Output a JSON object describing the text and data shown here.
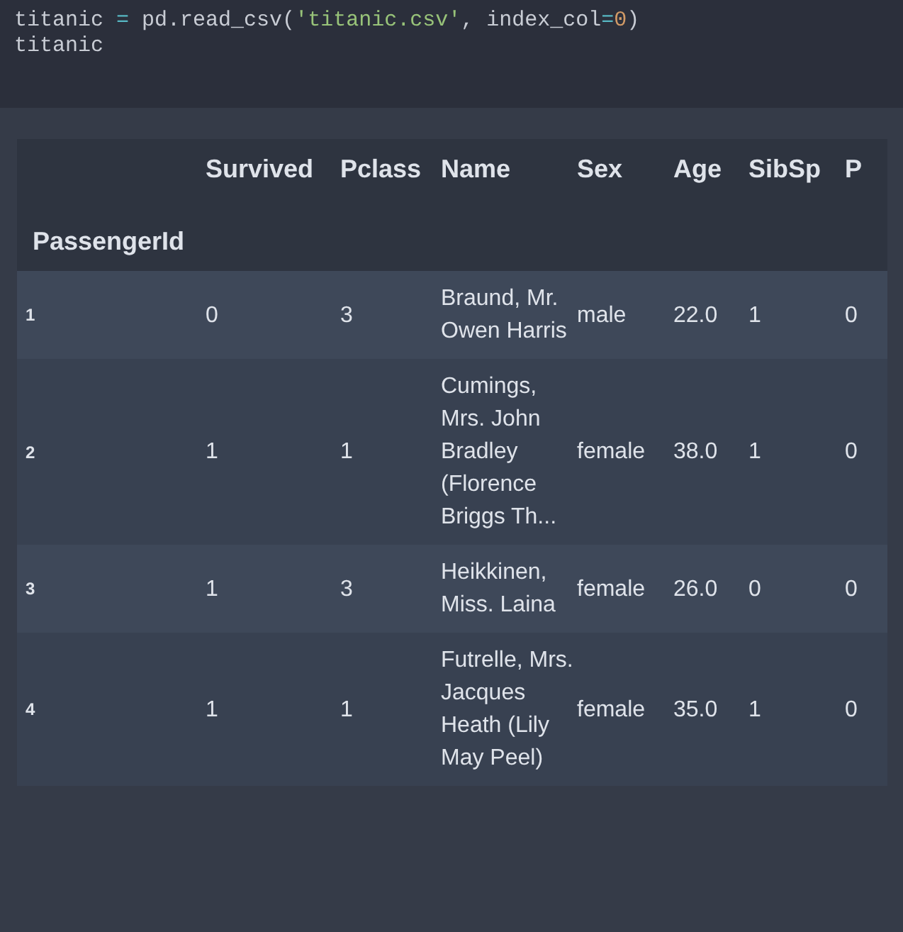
{
  "code_cell": {
    "lines": [
      [
        {
          "kind": "plain",
          "text": "titanic "
        },
        {
          "kind": "operator",
          "text": "="
        },
        {
          "kind": "plain",
          "text": " pd.read_csv("
        },
        {
          "kind": "string",
          "text": "'titanic.csv'"
        },
        {
          "kind": "plain",
          "text": ", index_col"
        },
        {
          "kind": "operator",
          "text": "="
        },
        {
          "kind": "number",
          "text": "0"
        },
        {
          "kind": "plain",
          "text": ")"
        }
      ],
      [
        {
          "kind": "plain",
          "text": "titanic"
        }
      ]
    ]
  },
  "table": {
    "index_name": "PassengerId",
    "columns": [
      "Survived",
      "Pclass",
      "Name",
      "Sex",
      "Age",
      "SibSp",
      "P"
    ],
    "rows": [
      {
        "index": "1",
        "cells": [
          "0",
          "3",
          "Braund, Mr. Owen Harris",
          "male",
          "22.0",
          "1",
          "0"
        ]
      },
      {
        "index": "2",
        "cells": [
          "1",
          "1",
          "Cumings, Mrs. John Bradley (Florence Briggs Th...",
          "female",
          "38.0",
          "1",
          "0"
        ]
      },
      {
        "index": "3",
        "cells": [
          "1",
          "3",
          "Heikkinen, Miss. Laina",
          "female",
          "26.0",
          "0",
          "0"
        ]
      },
      {
        "index": "4",
        "cells": [
          "1",
          "1",
          "Futrelle, Mrs. Jacques Heath (Lily May Peel)",
          "female",
          "35.0",
          "1",
          "0"
        ]
      }
    ]
  }
}
